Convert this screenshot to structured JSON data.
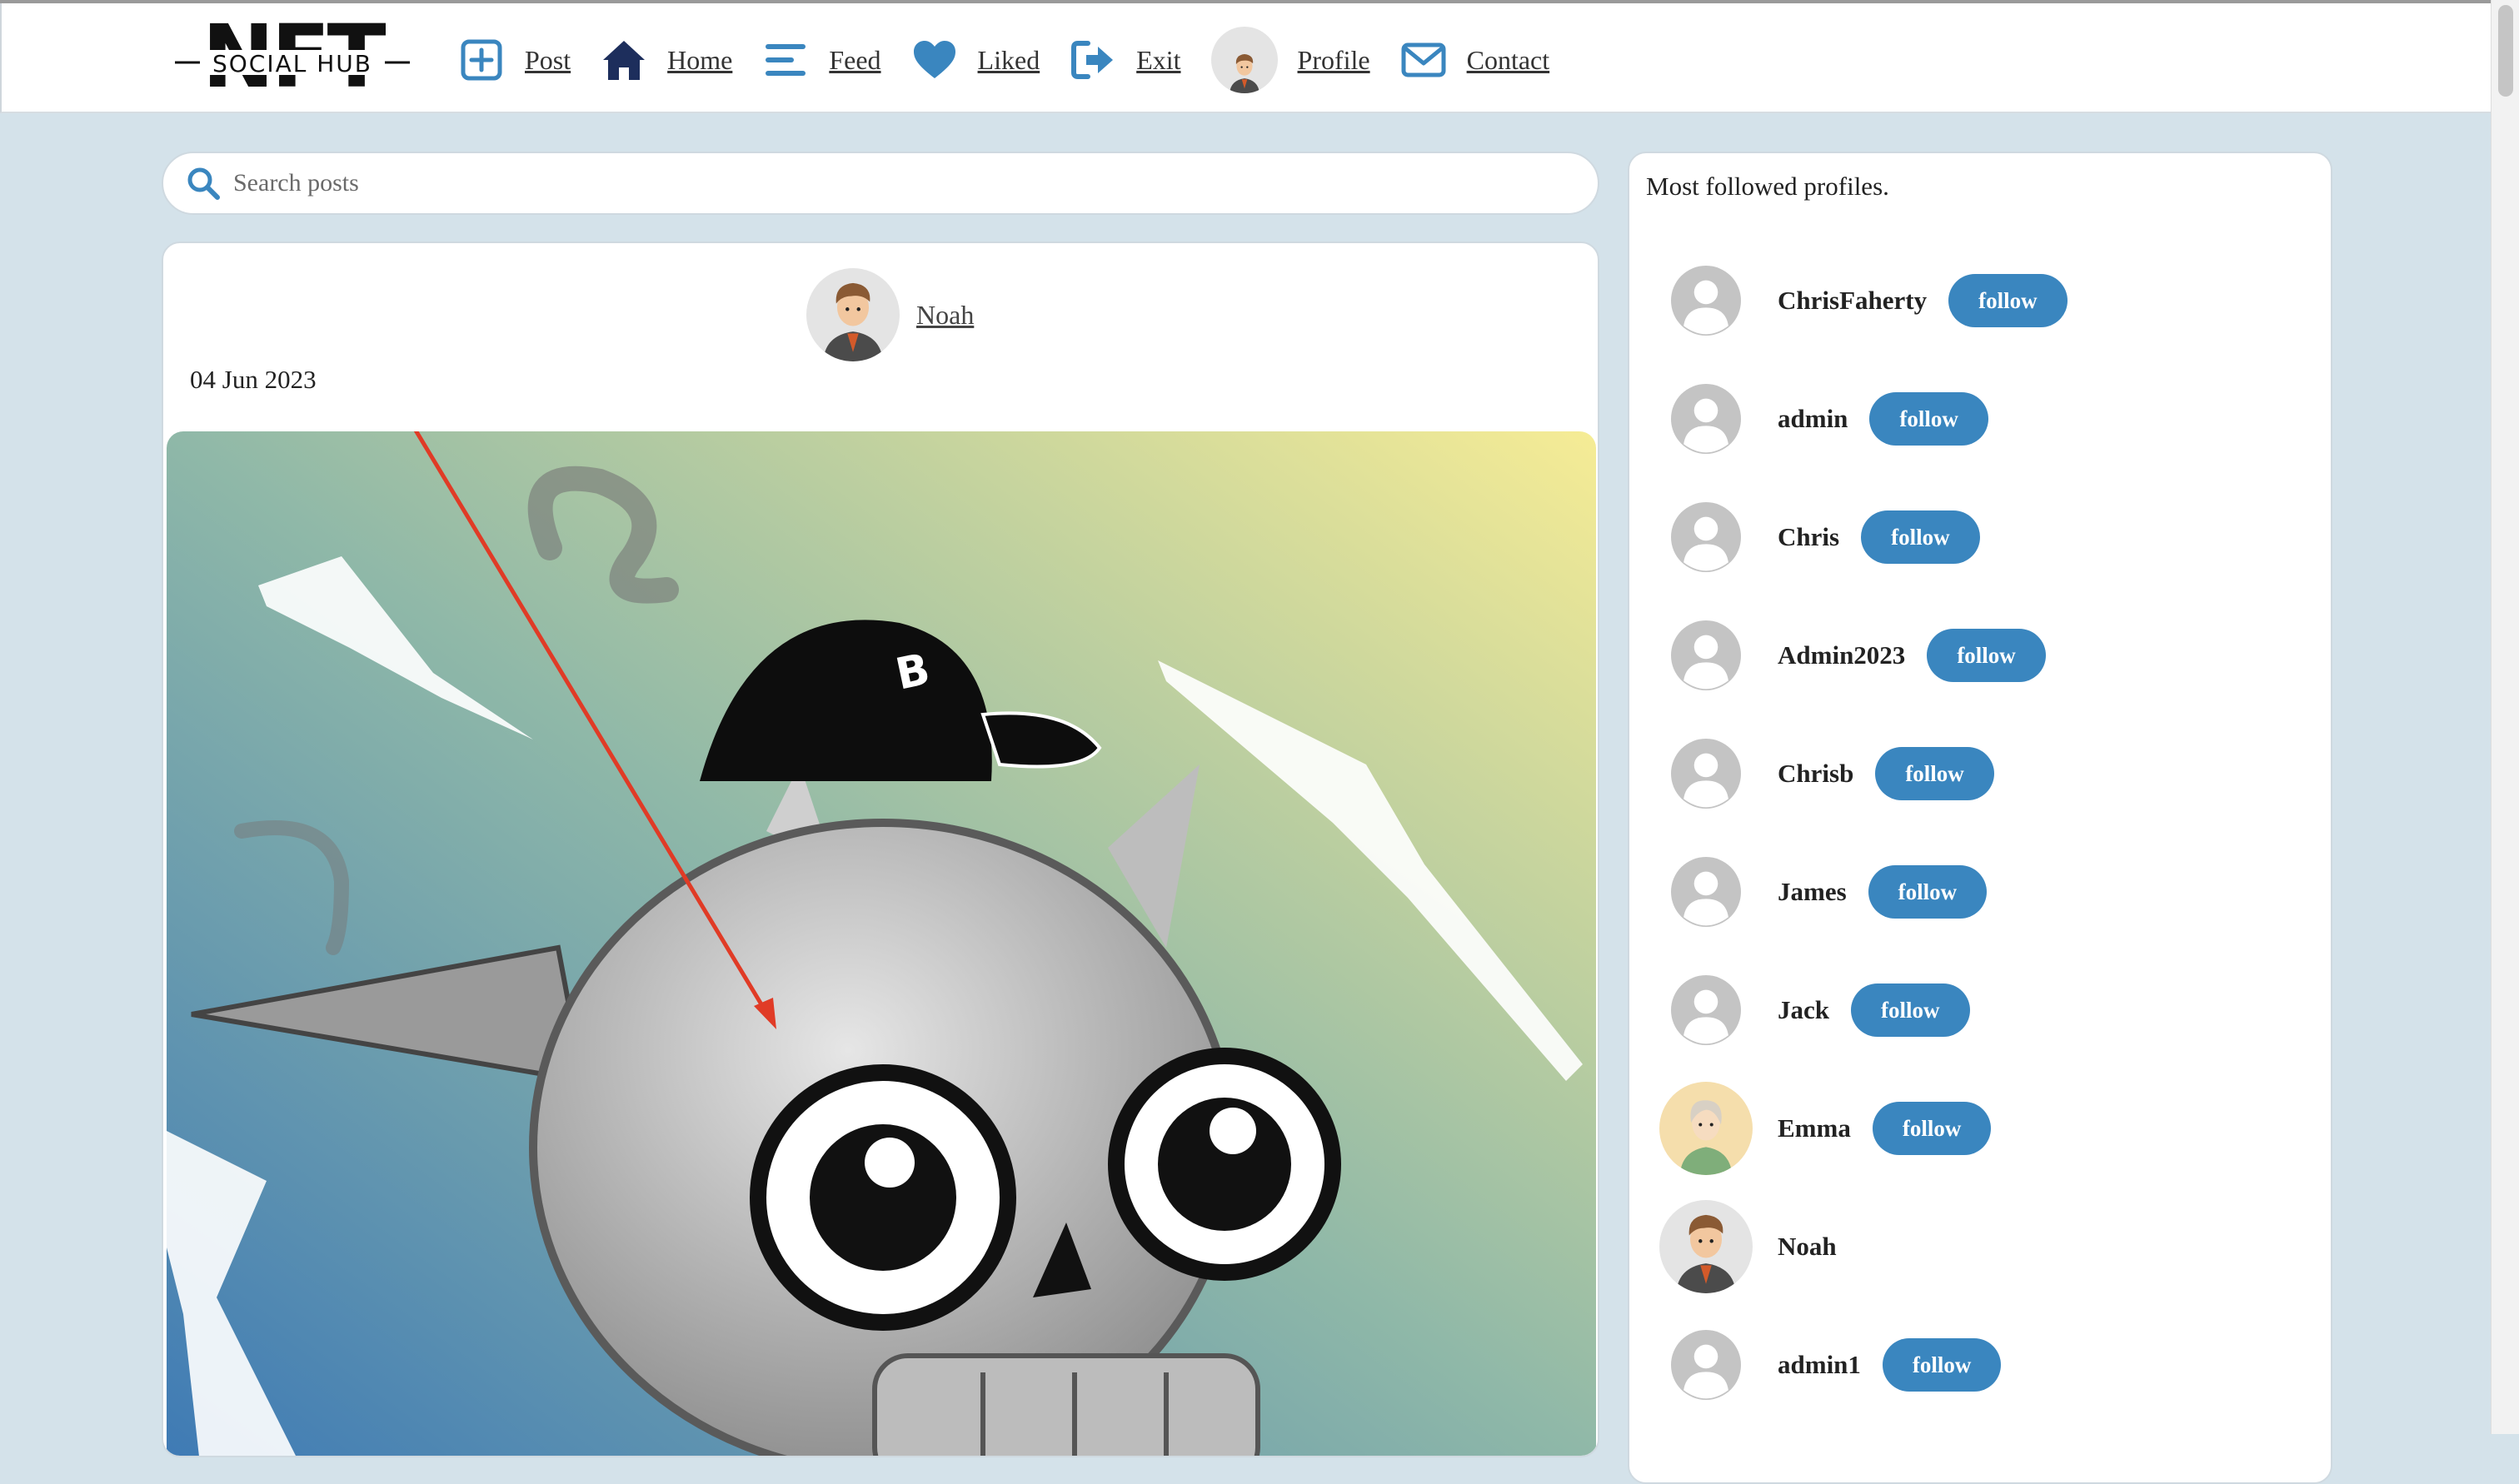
{
  "nav": {
    "logo_text_top": "NFT",
    "logo_text_sub": "SOCIAL HUB",
    "items": [
      {
        "label": "Post",
        "icon": "plus-square-icon"
      },
      {
        "label": "Home",
        "icon": "home-icon"
      },
      {
        "label": "Feed",
        "icon": "menu-lines-icon"
      },
      {
        "label": "Liked",
        "icon": "heart-icon"
      },
      {
        "label": "Exit",
        "icon": "sign-out-icon"
      },
      {
        "label": "Profile",
        "icon": "avatar"
      },
      {
        "label": "Contact",
        "icon": "envelope-icon"
      }
    ]
  },
  "search": {
    "placeholder": "Search posts",
    "value": ""
  },
  "post": {
    "author": "Noah",
    "date": "04 Jun 2023"
  },
  "sidebar": {
    "title": "Most followed profiles.",
    "profiles": [
      {
        "name": "ChrisFaherty",
        "follow_label": "follow"
      },
      {
        "name": "admin",
        "follow_label": "follow"
      },
      {
        "name": "Chris",
        "follow_label": "follow"
      },
      {
        "name": "Admin2023",
        "follow_label": "follow"
      },
      {
        "name": "Chrisb",
        "follow_label": "follow"
      },
      {
        "name": "James",
        "follow_label": "follow"
      },
      {
        "name": "Jack",
        "follow_label": "follow"
      },
      {
        "name": "Emma",
        "follow_label": "follow"
      },
      {
        "name": "Noah",
        "follow_label": ""
      },
      {
        "name": "admin1",
        "follow_label": "follow"
      }
    ]
  },
  "colors": {
    "accent": "#3a86bf",
    "page_bg": "#d4e2ea",
    "nav_icon": "#3a86bf",
    "home_icon": "#1d2e5c"
  }
}
